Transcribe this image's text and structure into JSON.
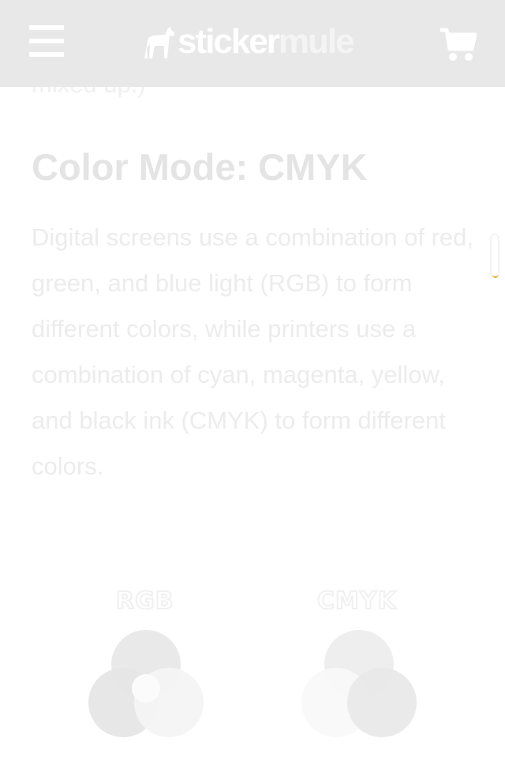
{
  "header": {
    "logo_part1": "sticker",
    "logo_part2": "mule",
    "menu_icon": "hamburger-menu-icon",
    "cart_icon": "shopping-cart-icon",
    "background": "#e8e8e8"
  },
  "article": {
    "previous_text": "mixed up.)",
    "heading": "Color Mode: CMYK",
    "paragraph": "Digital screens use a combination of red, green, and blue light (RGB) to form different colors, while printers use a combination of cyan, magenta, yellow, and black ink (CMYK) to form different colors."
  },
  "diagrams": {
    "rgb_label": "RGB",
    "cmyk_label": "CMYK"
  }
}
